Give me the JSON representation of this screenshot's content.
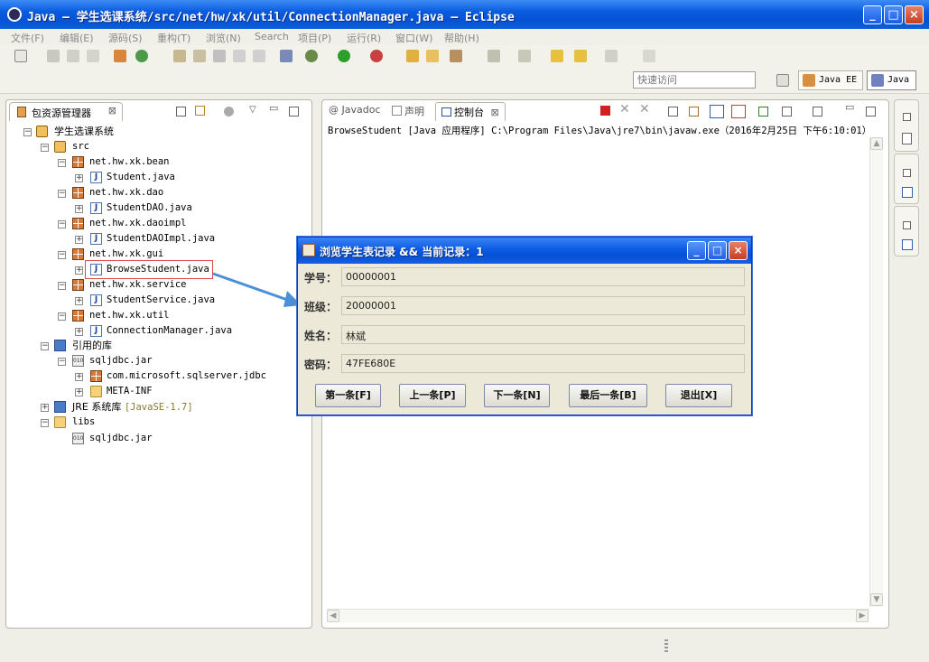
{
  "window": {
    "title": "Java — 学生选课系统/src/net/hw/xk/util/ConnectionManager.java — Eclipse"
  },
  "menu": [
    "文件(F)",
    "编辑(E)",
    "源码(S)",
    "重构(T)",
    "浏览(N)",
    "Search",
    "项目(P)",
    "运行(R)",
    "窗口(W)",
    "帮助(H)"
  ],
  "toolbar": {
    "quick_access_placeholder": "快速访问"
  },
  "perspectives": [
    "Java EE",
    "Java"
  ],
  "package_explorer": {
    "tab_label": "包资源管理器",
    "tree": {
      "project": "学生选课系统",
      "src": "src",
      "pkg_bean": "net.hw.xk.bean",
      "file_student": "Student.java",
      "pkg_dao": "net.hw.xk.dao",
      "file_studentdao": "StudentDAO.java",
      "pkg_daoimpl": "net.hw.xk.daoimpl",
      "file_studentdaoimpl": "StudentDAOImpl.java",
      "pkg_gui": "net.hw.xk.gui",
      "file_browse": "BrowseStudent.java",
      "pkg_service": "net.hw.xk.service",
      "file_service": "StudentService.java",
      "pkg_util": "net.hw.xk.util",
      "file_conn": "ConnectionManager.java",
      "ref_libs": "引用的库",
      "jar_ref": "sqljdbc.jar",
      "pkg_jdbc": "com.microsoft.sqlserver.jdbc",
      "meta_inf": "META-INF",
      "jre": "JRE 系统库",
      "jre_version": "[JavaSE-1.7]",
      "libs": "libs",
      "libs_jar": "sqljdbc.jar"
    }
  },
  "console_panel": {
    "tabs": [
      "Javadoc",
      "声明",
      "控制台"
    ],
    "header_line": "BrowseStudent [Java 应用程序] C:\\Program Files\\Java\\jre7\\bin\\javaw.exe（2016年2月25日 下午6:10:01）"
  },
  "dialog": {
    "title": "浏览学生表记录 && 当前记录：1",
    "fields": [
      {
        "label": "学号：",
        "value": "00000001"
      },
      {
        "label": "班级：",
        "value": "20000001"
      },
      {
        "label": "姓名：",
        "value": "林斌"
      },
      {
        "label": "密码：",
        "value": "47FE680E"
      }
    ],
    "buttons": [
      "第一条[F]",
      "上一条[P]",
      "下一条[N]",
      "最后一条[B]",
      "退出[X]"
    ]
  },
  "colors": {
    "titlebar": "#0a5ce0",
    "highlight_box": "#e0484b",
    "arrow": "#4a90d9",
    "jre_version": "#8a7a30"
  }
}
